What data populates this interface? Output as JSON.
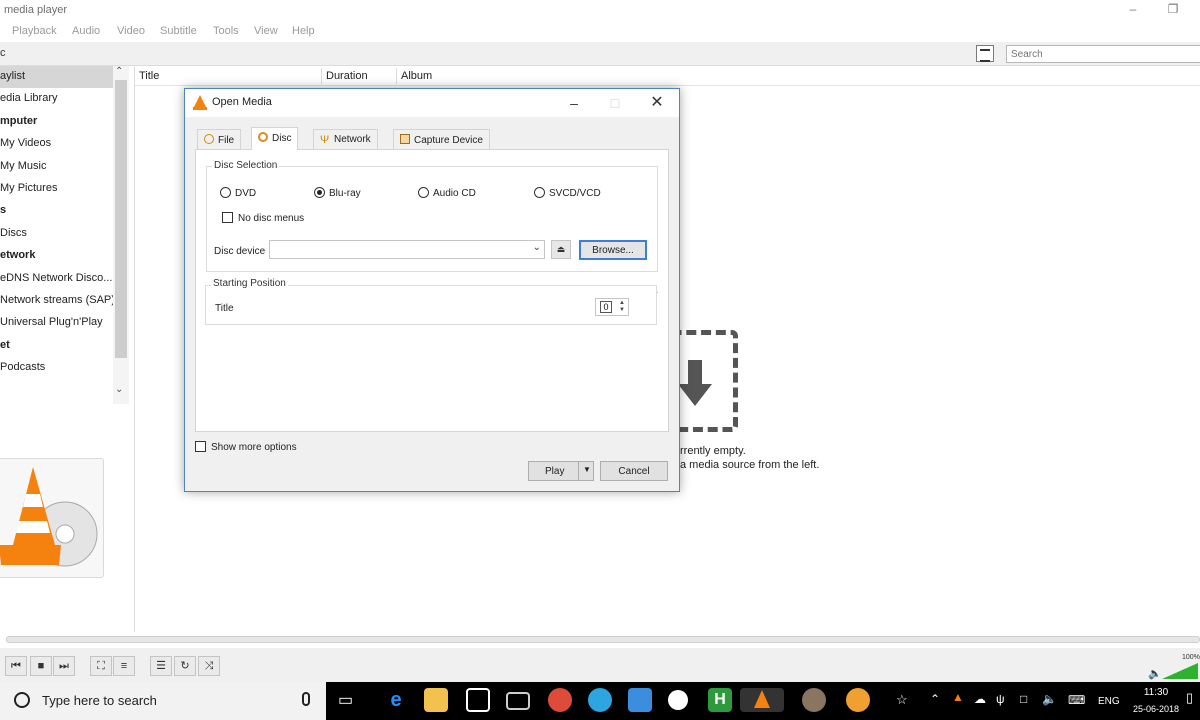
{
  "window": {
    "title": "media player"
  },
  "menu": [
    "Playback",
    "Audio",
    "Video",
    "Subtitle",
    "Tools",
    "View",
    "Help"
  ],
  "toolbar": {
    "corner_text": "c",
    "search_placeholder": "Search"
  },
  "sidebar": {
    "items": [
      {
        "label": "aylist",
        "selected": true,
        "header": false
      },
      {
        "label": "edia Library",
        "selected": false,
        "header": false
      },
      {
        "label": "mputer",
        "selected": false,
        "header": true
      },
      {
        "label": "My Videos",
        "selected": false,
        "header": false
      },
      {
        "label": "My Music",
        "selected": false,
        "header": false
      },
      {
        "label": "My Pictures",
        "selected": false,
        "header": false
      },
      {
        "label": "s",
        "selected": false,
        "header": true
      },
      {
        "label": "Discs",
        "selected": false,
        "header": false
      },
      {
        "label": "etwork",
        "selected": false,
        "header": true
      },
      {
        "label": "eDNS Network Disco...",
        "selected": false,
        "header": false
      },
      {
        "label": "Network streams (SAP)",
        "selected": false,
        "header": false
      },
      {
        "label": "Universal Plug'n'Play",
        "selected": false,
        "header": false
      },
      {
        "label": "et",
        "selected": false,
        "header": true
      },
      {
        "label": "Podcasts",
        "selected": false,
        "header": false
      }
    ]
  },
  "playlist": {
    "columns": [
      "Title",
      "Duration",
      "Album"
    ],
    "empty_line1": "rrently empty.",
    "empty_line2": "a media source from the left."
  },
  "controls": {
    "volume_label": "100%"
  },
  "dialog": {
    "title": "Open Media",
    "tabs": [
      {
        "label": "File",
        "active": false
      },
      {
        "label": "Disc",
        "active": true
      },
      {
        "label": "Network",
        "active": false
      },
      {
        "label": "Capture Device",
        "active": false
      }
    ],
    "disc_selection": {
      "label": "Disc Selection",
      "options": [
        {
          "label": "DVD",
          "selected": false
        },
        {
          "label": "Blu-ray",
          "selected": true
        },
        {
          "label": "Audio CD",
          "selected": false
        },
        {
          "label": "SVCD/VCD",
          "selected": false
        }
      ],
      "no_disc_menus_label": "No disc menus",
      "no_disc_menus_checked": false,
      "disc_device_label": "Disc device",
      "disc_device_value": "",
      "browse_label": "Browse..."
    },
    "starting_position": {
      "label": "Starting Position",
      "title_label": "Title",
      "title_value": "0"
    },
    "show_more_options_label": "Show more options",
    "play_label": "Play",
    "cancel_label": "Cancel"
  },
  "taskbar": {
    "search_text": "Type here to search",
    "language": "ENG",
    "time": "11:30",
    "date": "25-06-2018"
  }
}
